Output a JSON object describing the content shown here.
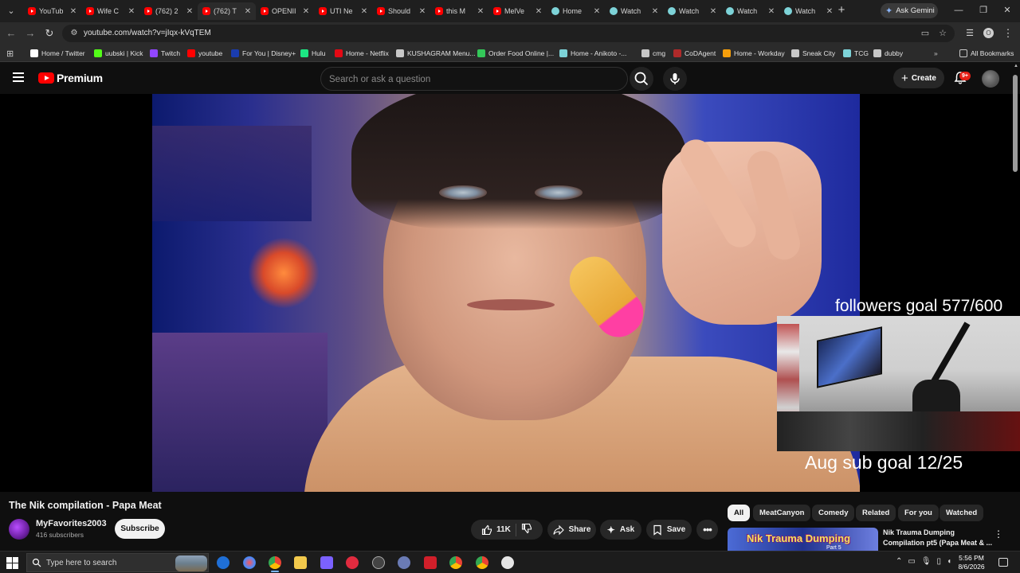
{
  "browser": {
    "tabs": [
      {
        "label": "YouTub",
        "icon": "youtube-icon",
        "active": false
      },
      {
        "label": "Wife C",
        "icon": "youtube-icon",
        "active": false
      },
      {
        "label": "(762) 2",
        "icon": "youtube-icon",
        "active": false
      },
      {
        "label": "(762) T",
        "icon": "youtube-icon",
        "active": true
      },
      {
        "label": "OPENII",
        "icon": "youtube-icon",
        "active": false
      },
      {
        "label": "UTI Ne",
        "icon": "youtube-icon",
        "active": false
      },
      {
        "label": "Should",
        "icon": "youtube-icon",
        "active": false
      },
      {
        "label": "this M",
        "icon": "youtube-icon",
        "active": false
      },
      {
        "label": "MelVe",
        "icon": "youtube-icon",
        "active": false
      },
      {
        "label": "Home",
        "icon": "globe-icon",
        "active": false
      },
      {
        "label": "Watch",
        "icon": "globe-icon",
        "active": false
      },
      {
        "label": "Watch",
        "icon": "globe-icon",
        "active": false
      },
      {
        "label": "Watch",
        "icon": "globe-icon",
        "active": false
      },
      {
        "label": "Watch",
        "icon": "globe-icon",
        "active": false
      }
    ],
    "ask_gemini_label": "Ask Gemini",
    "url": "youtube.com/watch?v=jIqx-kVqTEM",
    "profile_letter": "O",
    "bookmarks": [
      {
        "label": "Home / Twitter",
        "color": "#ffffff"
      },
      {
        "label": "uubski | Kick",
        "color": "#53fc18"
      },
      {
        "label": "Twitch",
        "color": "#9146ff"
      },
      {
        "label": "youtube",
        "color": "#ff0000"
      },
      {
        "label": "For You | Disney+",
        "color": "#1a3cae"
      },
      {
        "label": "Hulu",
        "color": "#1ce783"
      },
      {
        "label": "Home - Netflix",
        "color": "#e50914"
      },
      {
        "label": "KUSHAGRAM Menu...",
        "color": "#c8c8c8"
      },
      {
        "label": "Order Food Online |...",
        "color": "#34c759"
      },
      {
        "label": "Home - Anikoto -...",
        "color": "#7dd3d8"
      },
      {
        "label": "cmg",
        "color": "#c8c8c8"
      },
      {
        "label": "CoDAgent",
        "color": "#b02a2a"
      },
      {
        "label": "Home - Workday",
        "color": "#f59e0b"
      },
      {
        "label": "Sneak City",
        "color": "#c8c8c8"
      },
      {
        "label": "TCG",
        "color": "#7dd3d8"
      },
      {
        "label": "dubby",
        "color": "#c8c8c8"
      }
    ],
    "all_bookmarks_label": "All Bookmarks"
  },
  "youtube": {
    "logo_text": "Premium",
    "search_placeholder": "Search or ask a question",
    "create_label": "Create",
    "notification_count": "9+",
    "overlay": {
      "followers_goal": "followers goal 577/600",
      "sub_goal": "Aug sub goal 12/25"
    },
    "video": {
      "title": "The Nik compilation - Papa Meat",
      "channel_name": "MyFavorites2003",
      "subscribers": "416 subscribers",
      "subscribe_label": "Subscribe",
      "likes": "11K",
      "share_label": "Share",
      "ask_label": "Ask",
      "save_label": "Save"
    },
    "chips": [
      "All",
      "MeatCanyon",
      "Comedy",
      "Related",
      "For you",
      "Watched"
    ],
    "recommendation": {
      "thumb_text": "Nik Trauma Dumping",
      "thumb_part": "Part 5",
      "title": "Nik Trauma Dumping Compilation pt5 (Papa Meat & ..."
    }
  },
  "taskbar": {
    "search_placeholder": "Type here to search",
    "time": "5:56 PM",
    "date": "8/6/2026"
  }
}
